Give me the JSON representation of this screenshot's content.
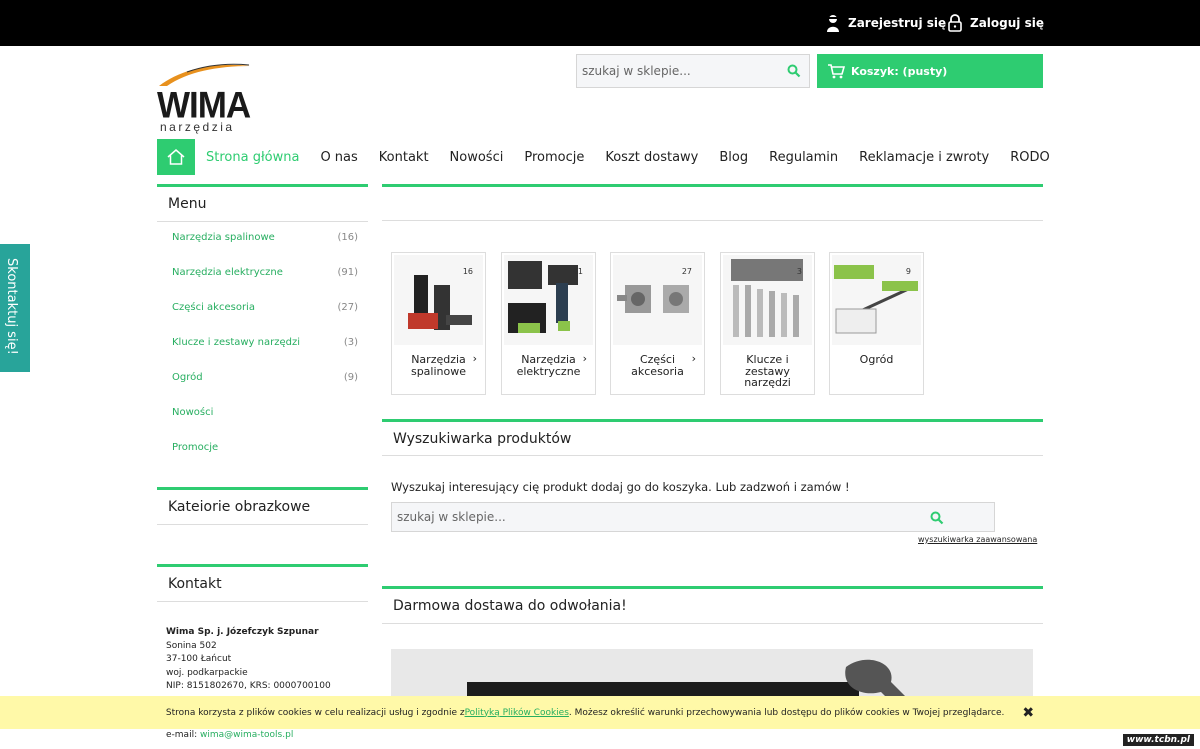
{
  "account": {
    "register": "Zarejestruj się",
    "login": "Zaloguj się"
  },
  "logo": {
    "name": "WIMA",
    "tagline": "narzędzia"
  },
  "search": {
    "placeholder": "szukaj w sklepie..."
  },
  "cart": {
    "label": "Koszyk: (pusty)"
  },
  "nav": [
    "Strona główna",
    "O nas",
    "Kontakt",
    "Nowości",
    "Promocje",
    "Koszt dostawy",
    "Blog",
    "Regulamin",
    "Reklamacje i zwroty",
    "RODO"
  ],
  "sidebar": {
    "menu_title": "Menu",
    "items": [
      {
        "label": "Narzędzia spalinowe",
        "count": "(16)"
      },
      {
        "label": "Narzędzia elektryczne",
        "count": "(91)"
      },
      {
        "label": "Części akcesoria",
        "count": "(27)"
      },
      {
        "label": "Klucze i zestawy narzędzi",
        "count": "(3)"
      },
      {
        "label": "Ogród",
        "count": "(9)"
      },
      {
        "label": "Nowości",
        "count": ""
      },
      {
        "label": "Promocje",
        "count": ""
      }
    ],
    "image_categories_title": "Kateiorie obrazkowe",
    "contact_title": "Kontakt",
    "contact": {
      "company": "Wima Sp. j. Józefczyk Szpunar",
      "street": "Sonina 502",
      "city": "37-100 Łańcut",
      "region": "woj. podkarpackie",
      "ids": "NIP: 8151802670, KRS: 0000700100",
      "email_label": "e-mail:",
      "email": "wima@wima-tools.pl"
    }
  },
  "side_tab": "Skontaktuj się!",
  "categories": [
    {
      "label": "Narzędzia spalinowe",
      "count": "16",
      "arrow": "›"
    },
    {
      "label": "Narzędzia elektryczne",
      "count": "91",
      "arrow": "›"
    },
    {
      "label": "Części akcesoria",
      "count": "27",
      "arrow": "›"
    },
    {
      "label": "Klucze i zestawy narzędzi",
      "count": "3",
      "arrow": ""
    },
    {
      "label": "Ogród",
      "count": "9",
      "arrow": ""
    }
  ],
  "finder": {
    "title": "Wyszukiwarka produktów",
    "text": "Wyszukaj interesujący cię produkt dodaj go do koszyka. Lub zadzwoń i zamów !",
    "advanced": "wyszukiwarka zaawansowana"
  },
  "free_delivery": {
    "title": "Darmowa dostawa do odwołania!"
  },
  "cookie": {
    "before": "Strona korzysta z plików cookies w celu realizacji usług i zgodnie z ",
    "link": "Polityką Plików Cookies",
    "after": ". Możesz określić warunki przechowywania lub dostępu do plików cookies w Twojej przeglądarce.",
    "close": "✖"
  },
  "watermark": "www.tcbn.pl",
  "colors": {
    "accent": "#2ecc71",
    "teal": "#28a49a",
    "cookie_bg": "#fff9a8"
  }
}
